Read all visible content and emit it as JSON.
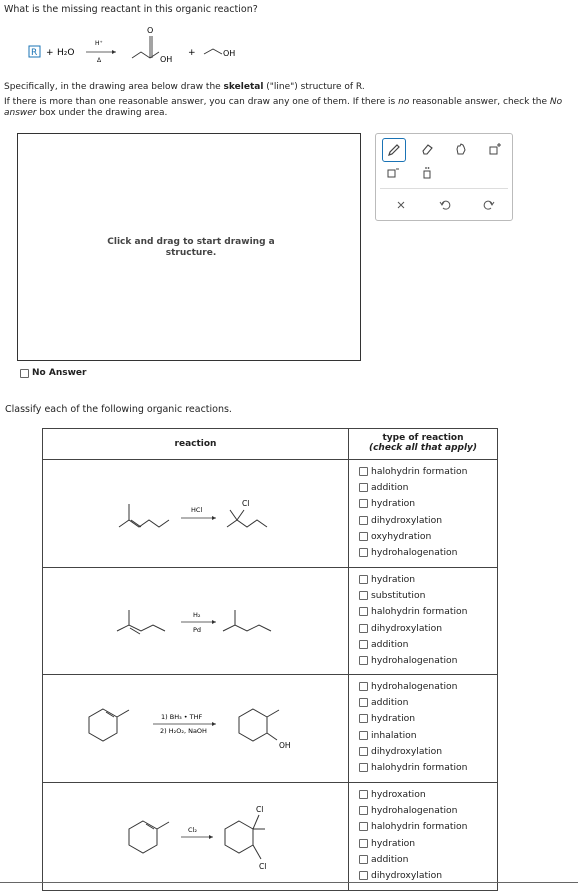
{
  "question1": "What is the missing reactant in this organic reaction?",
  "equation": {
    "box_label": "R",
    "plus1": "+",
    "water": "H₂O",
    "catalyst_top": "H⁺",
    "catalyst_bottom": "Δ",
    "oh1": "OH",
    "plus2": "+",
    "oh2": "OH",
    "carbonyl_o": "O"
  },
  "instructions": {
    "specifically_pre": "Specifically, in the drawing area below draw the ",
    "specifically_bold": "skeletal",
    "specifically_post": " (\"line\") structure of R.",
    "ifmore_pre": "If there is more than one reasonable answer, you can draw any one of them. If there is ",
    "ifmore_italic": "no",
    "ifmore_mid": " reasonable answer, check the ",
    "ifmore_italic2": "No answer",
    "ifmore_post": " box under the drawing area."
  },
  "drawing_area": {
    "hint": "Click and drag to start drawing a structure."
  },
  "no_answer_label": "No Answer",
  "question2": "Classify each of the following organic reactions.",
  "table": {
    "header_reaction": "reaction",
    "header_type_line1": "type of reaction",
    "header_type_line2": "(check all that apply)",
    "rows": [
      {
        "reagent_top": "HCl",
        "reagent_bottom": "",
        "product_label": "Cl",
        "product_label2": "",
        "options": [
          "halohydrin formation",
          "addition",
          "hydration",
          "dihydroxylation",
          "oxyhydration",
          "hydrohalogenation"
        ]
      },
      {
        "reagent_top": "H₂",
        "reagent_bottom": "Pd",
        "product_label": "",
        "product_label2": "",
        "options": [
          "hydration",
          "substitution",
          "halohydrin formation",
          "dihydroxylation",
          "addition",
          "hydrohalogenation"
        ]
      },
      {
        "reagent_top": "1) BH₃ • THF",
        "reagent_bottom": "2) H₂O₂, NaOH",
        "product_label": "OH",
        "product_label2": "",
        "options": [
          "hydrohalogenation",
          "addition",
          "hydration",
          "inhalation",
          "dihydroxylation",
          "halohydrin formation"
        ]
      },
      {
        "reagent_top": "Cl₂",
        "reagent_bottom": "",
        "product_label": "Cl",
        "product_label2": "Cl",
        "options": [
          "hydroxation",
          "hydrohalogenation",
          "halohydrin formation",
          "hydration",
          "addition",
          "dihydroxylation"
        ]
      }
    ]
  }
}
